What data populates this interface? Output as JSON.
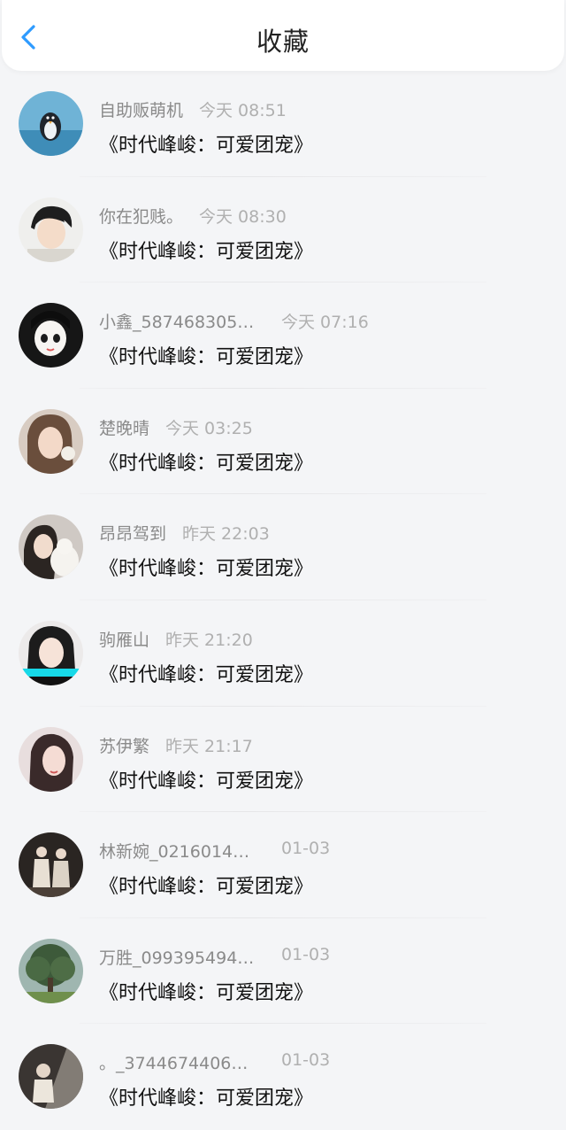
{
  "header": {
    "title": "收藏",
    "back_icon": "chevron-left-icon",
    "accent_color": "#2e9bff"
  },
  "items": [
    {
      "name": "自助贩萌机",
      "time": "今天 08:51",
      "title": "《时代峰峻：可爱团宠》",
      "avatar": "penguin"
    },
    {
      "name": "你在犯贱。",
      "time": "今天 08:30",
      "title": "《时代峰峻：可爱团宠》",
      "avatar": "boy-drawing"
    },
    {
      "name": "小鑫_587468305…",
      "time": "今天 07:16",
      "title": "《时代峰峻：可爱团宠》",
      "avatar": "anime-girl"
    },
    {
      "name": "楚晚晴",
      "time": "今天 03:25",
      "title": "《时代峰峻：可爱团宠》",
      "avatar": "girl-portrait"
    },
    {
      "name": "昂昂驾到",
      "time": "昨天 22:03",
      "title": "《时代峰峻：可爱团宠》",
      "avatar": "girl-with-doll"
    },
    {
      "name": "驹雁山",
      "time": "昨天 21:20",
      "title": "《时代峰峻：可爱团宠》",
      "avatar": "girl-cyan-band"
    },
    {
      "name": "苏伊繁",
      "time": "昨天 21:17",
      "title": "《时代峰峻：可爱团宠》",
      "avatar": "girl-portrait-2"
    },
    {
      "name": "林新婉_0216014…",
      "time": "01-03",
      "title": "《时代峰峻：可爱团宠》",
      "avatar": "two-figures"
    },
    {
      "name": "万胜_099395494…",
      "time": "01-03",
      "title": "《时代峰峻：可爱团宠》",
      "avatar": "tree"
    },
    {
      "name": "。_3744674406…",
      "time": "01-03",
      "title": "《时代峰峻：可爱团宠》",
      "avatar": "girl-light"
    }
  ]
}
